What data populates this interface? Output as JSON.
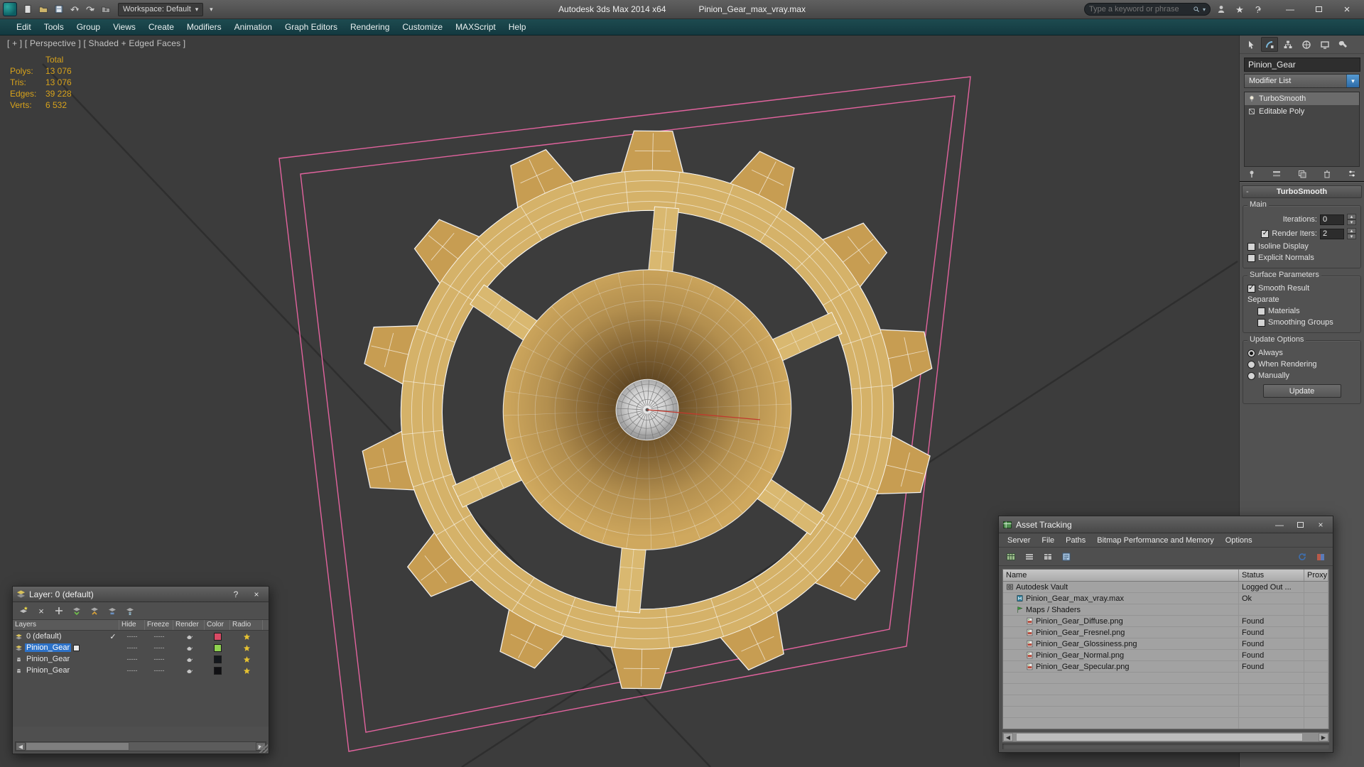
{
  "icons": {
    "dropdown": "▾",
    "up": "▴",
    "undo": "↶",
    "redo": "↷",
    "check": "✓",
    "close": "×",
    "minimize": "—",
    "maximize": "",
    "help": "?",
    "star": "★",
    "left": "◀",
    "right": "▶",
    "minus": "-",
    "question": "?"
  },
  "titlebar": {
    "workspace_label": "Workspace: Default",
    "app_title": "Autodesk 3ds Max 2014 x64",
    "doc_title": "Pinion_Gear_max_vray.max",
    "search_placeholder": "Type a keyword or phrase"
  },
  "menubar": {
    "items": [
      "Edit",
      "Tools",
      "Group",
      "Views",
      "Create",
      "Modifiers",
      "Animation",
      "Graph Editors",
      "Rendering",
      "Customize",
      "MAXScript",
      "Help"
    ]
  },
  "viewport": {
    "label": "[ + ] [ Perspective ] [ Shaded + Edged Faces ]",
    "stats": {
      "header": "Total",
      "rows": [
        {
          "label": "Polys:",
          "value": "13 076"
        },
        {
          "label": "Tris:",
          "value": "13 076"
        },
        {
          "label": "Edges:",
          "value": "39 228"
        },
        {
          "label": "Verts:",
          "value": "6 532"
        }
      ]
    }
  },
  "command_panel": {
    "object_name": "Pinion_Gear",
    "modifier_list_label": "Modifier List",
    "stack": [
      {
        "label": "TurboSmooth",
        "selected": true
      },
      {
        "label": "Editable Poly",
        "selected": false
      }
    ],
    "rollout": {
      "title": "TurboSmooth",
      "main_label": "Main",
      "iterations_label": "Iterations:",
      "iterations_value": "0",
      "render_iters_label": "Render Iters:",
      "render_iters_value": "2",
      "isoline_label": "Isoline Display",
      "explicit_label": "Explicit Normals",
      "surface_label": "Surface Parameters",
      "smooth_result_label": "Smooth Result",
      "separate_label": "Separate",
      "materials_label": "Materials",
      "smoothing_label": "Smoothing Groups",
      "update_label": "Update Options",
      "always_label": "Always",
      "when_rendering_label": "When Rendering",
      "manually_label": "Manually",
      "update_button": "Update"
    }
  },
  "layer_dialog": {
    "title": "Layer: 0 (default)",
    "na_text": "-----",
    "columns": [
      "Layers",
      "Hide",
      "Freeze",
      "Render",
      "Color",
      "Radio"
    ],
    "rows": [
      {
        "name": "0 (default)",
        "type": "layer",
        "current": true,
        "selected": false,
        "color": "#d84a64"
      },
      {
        "name": "Pinion_Gear",
        "type": "layer",
        "current": false,
        "selected": true,
        "color": "#8fd24f"
      },
      {
        "name": "Pinion_Gear",
        "type": "object",
        "current": false,
        "selected": false,
        "color": "#14181d"
      },
      {
        "name": "Pinion_Gear",
        "type": "object",
        "current": false,
        "selected": false,
        "color": "#101013"
      }
    ]
  },
  "asset_tracking": {
    "title": "Asset Tracking",
    "menus": [
      "Server",
      "File",
      "Paths",
      "Bitmap Performance and Memory",
      "Options"
    ],
    "columns": [
      "Name",
      "Status",
      "Proxy Re"
    ],
    "rows": [
      {
        "name": "Autodesk Vault",
        "status": "Logged Out ...",
        "indent": 0,
        "icon": "vault"
      },
      {
        "name": "Pinion_Gear_max_vray.max",
        "status": "Ok",
        "indent": 1,
        "icon": "maxdoc"
      },
      {
        "name": "Maps / Shaders",
        "status": "",
        "indent": 1,
        "icon": "flag"
      },
      {
        "name": "Pinion_Gear_Diffuse.png",
        "status": "Found",
        "indent": 2,
        "icon": "png"
      },
      {
        "name": "Pinion_Gear_Fresnel.png",
        "status": "Found",
        "indent": 2,
        "icon": "png"
      },
      {
        "name": "Pinion_Gear_Glossiness.png",
        "status": "Found",
        "indent": 2,
        "icon": "png"
      },
      {
        "name": "Pinion_Gear_Normal.png",
        "status": "Found",
        "indent": 2,
        "icon": "png"
      },
      {
        "name": "Pinion_Gear_Specular.png",
        "status": "Found",
        "indent": 2,
        "icon": "png"
      }
    ]
  }
}
